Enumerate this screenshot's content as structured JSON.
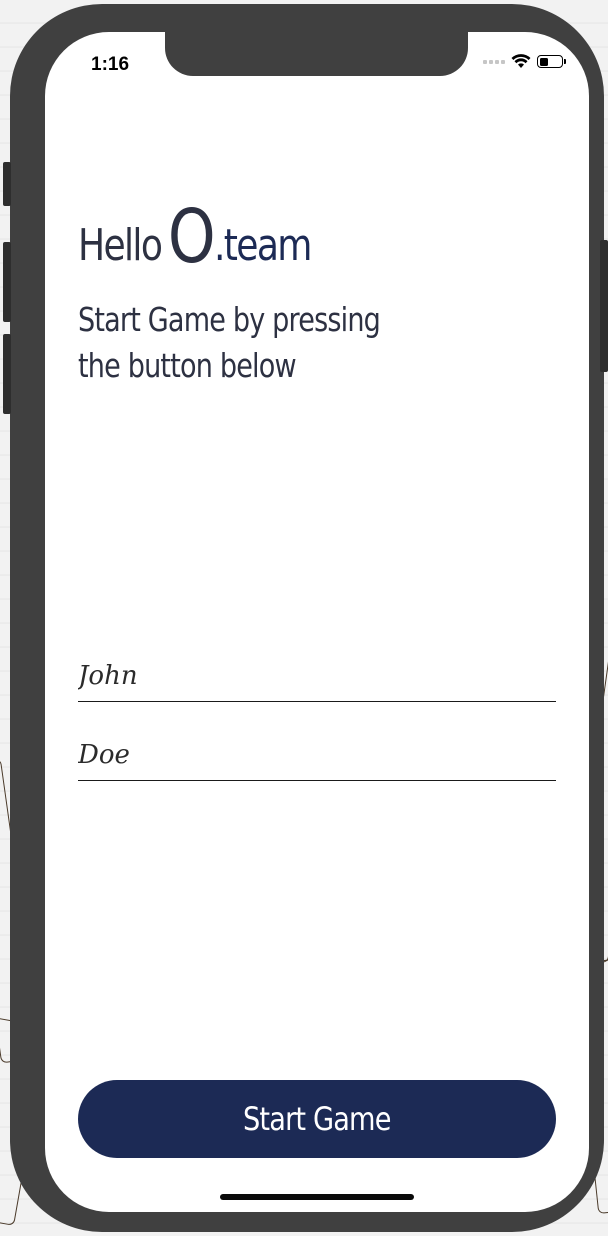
{
  "status_bar": {
    "time": "1:16",
    "signal_icon": "signal-dots-icon",
    "wifi_icon": "wifi-icon",
    "battery_icon": "battery-icon",
    "battery_level": 0.4
  },
  "header": {
    "hello": "Hello",
    "logo_letter": "O",
    "team": ".team"
  },
  "subtitle": {
    "line1": "Start Game by pressing",
    "line2": "the button below"
  },
  "form": {
    "first_name_value": "John",
    "last_name_value": "Doe"
  },
  "actions": {
    "start_label": "Start Game"
  },
  "colors": {
    "brand": "#1c2a55",
    "text": "#2d3142",
    "frame": "#404040"
  }
}
